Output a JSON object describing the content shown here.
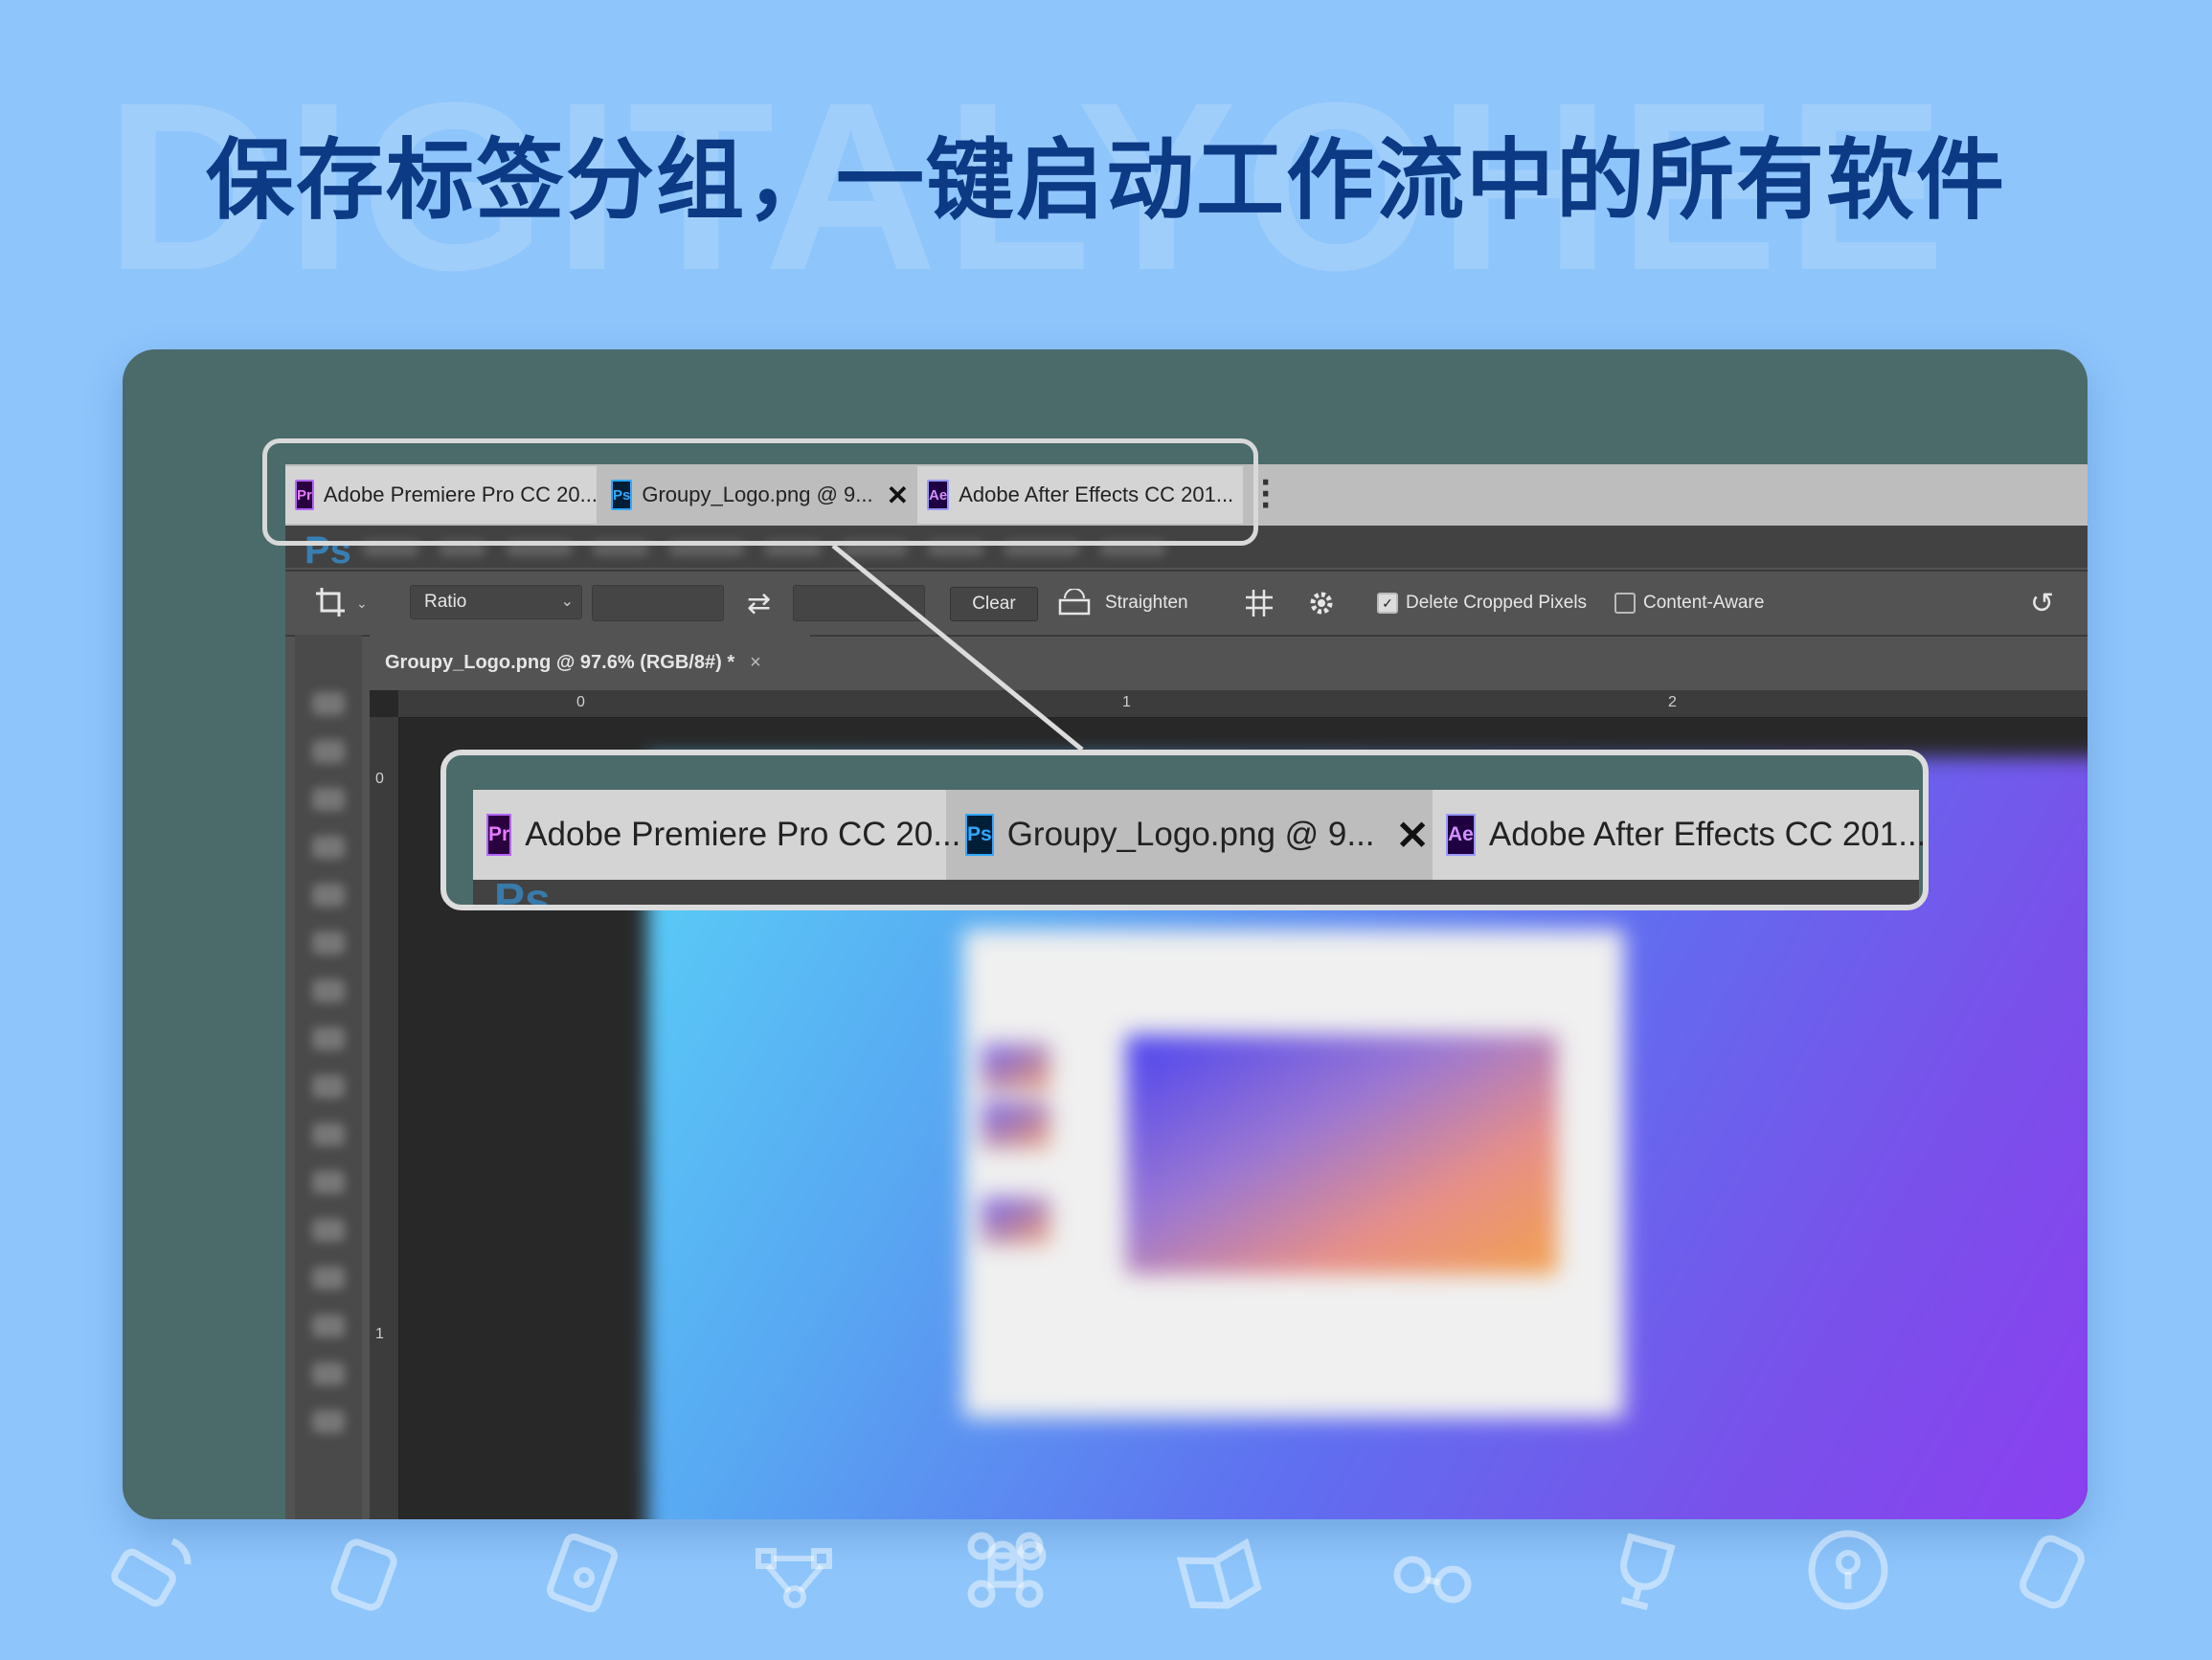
{
  "watermark": "DIGITALYOHEE",
  "headline": "保存标签分组，一键启动工作流中的所有软件",
  "tabs": [
    {
      "app": "Pr",
      "label": "Adobe Premiere Pro CC 20..."
    },
    {
      "app": "Ps",
      "label": "Groupy_Logo.png @ 9..."
    },
    {
      "app": "Ae",
      "label": "Adobe After Effects CC 201..."
    }
  ],
  "tab_close_glyph": "✕",
  "app_logo": "Ps",
  "options": {
    "ratio_label": "Ratio",
    "swap_icon": "⇄",
    "clear_label": "Clear",
    "straighten_label": "Straighten",
    "delete_cropped_label": "Delete Cropped Pixels",
    "delete_cropped_checked": true,
    "content_aware_label": "Content-Aware",
    "content_aware_checked": false
  },
  "document_tab": {
    "title": "Groupy_Logo.png @ 97.6% (RGB/8#) *",
    "close": "×"
  },
  "ruler": {
    "h_labels": [
      "0",
      "1",
      "2"
    ],
    "v_labels": [
      "0",
      "1"
    ]
  },
  "icons": {
    "crop": "crop-icon",
    "grid": "grid-overlay-icon",
    "gear": "gear-icon",
    "reset": "reset-icon",
    "level": "straighten-icon"
  },
  "colors": {
    "background": "#8ec5fb",
    "headline": "#0c3a85",
    "card": "#4b6a6a",
    "highlight": "#dcdcdc"
  }
}
